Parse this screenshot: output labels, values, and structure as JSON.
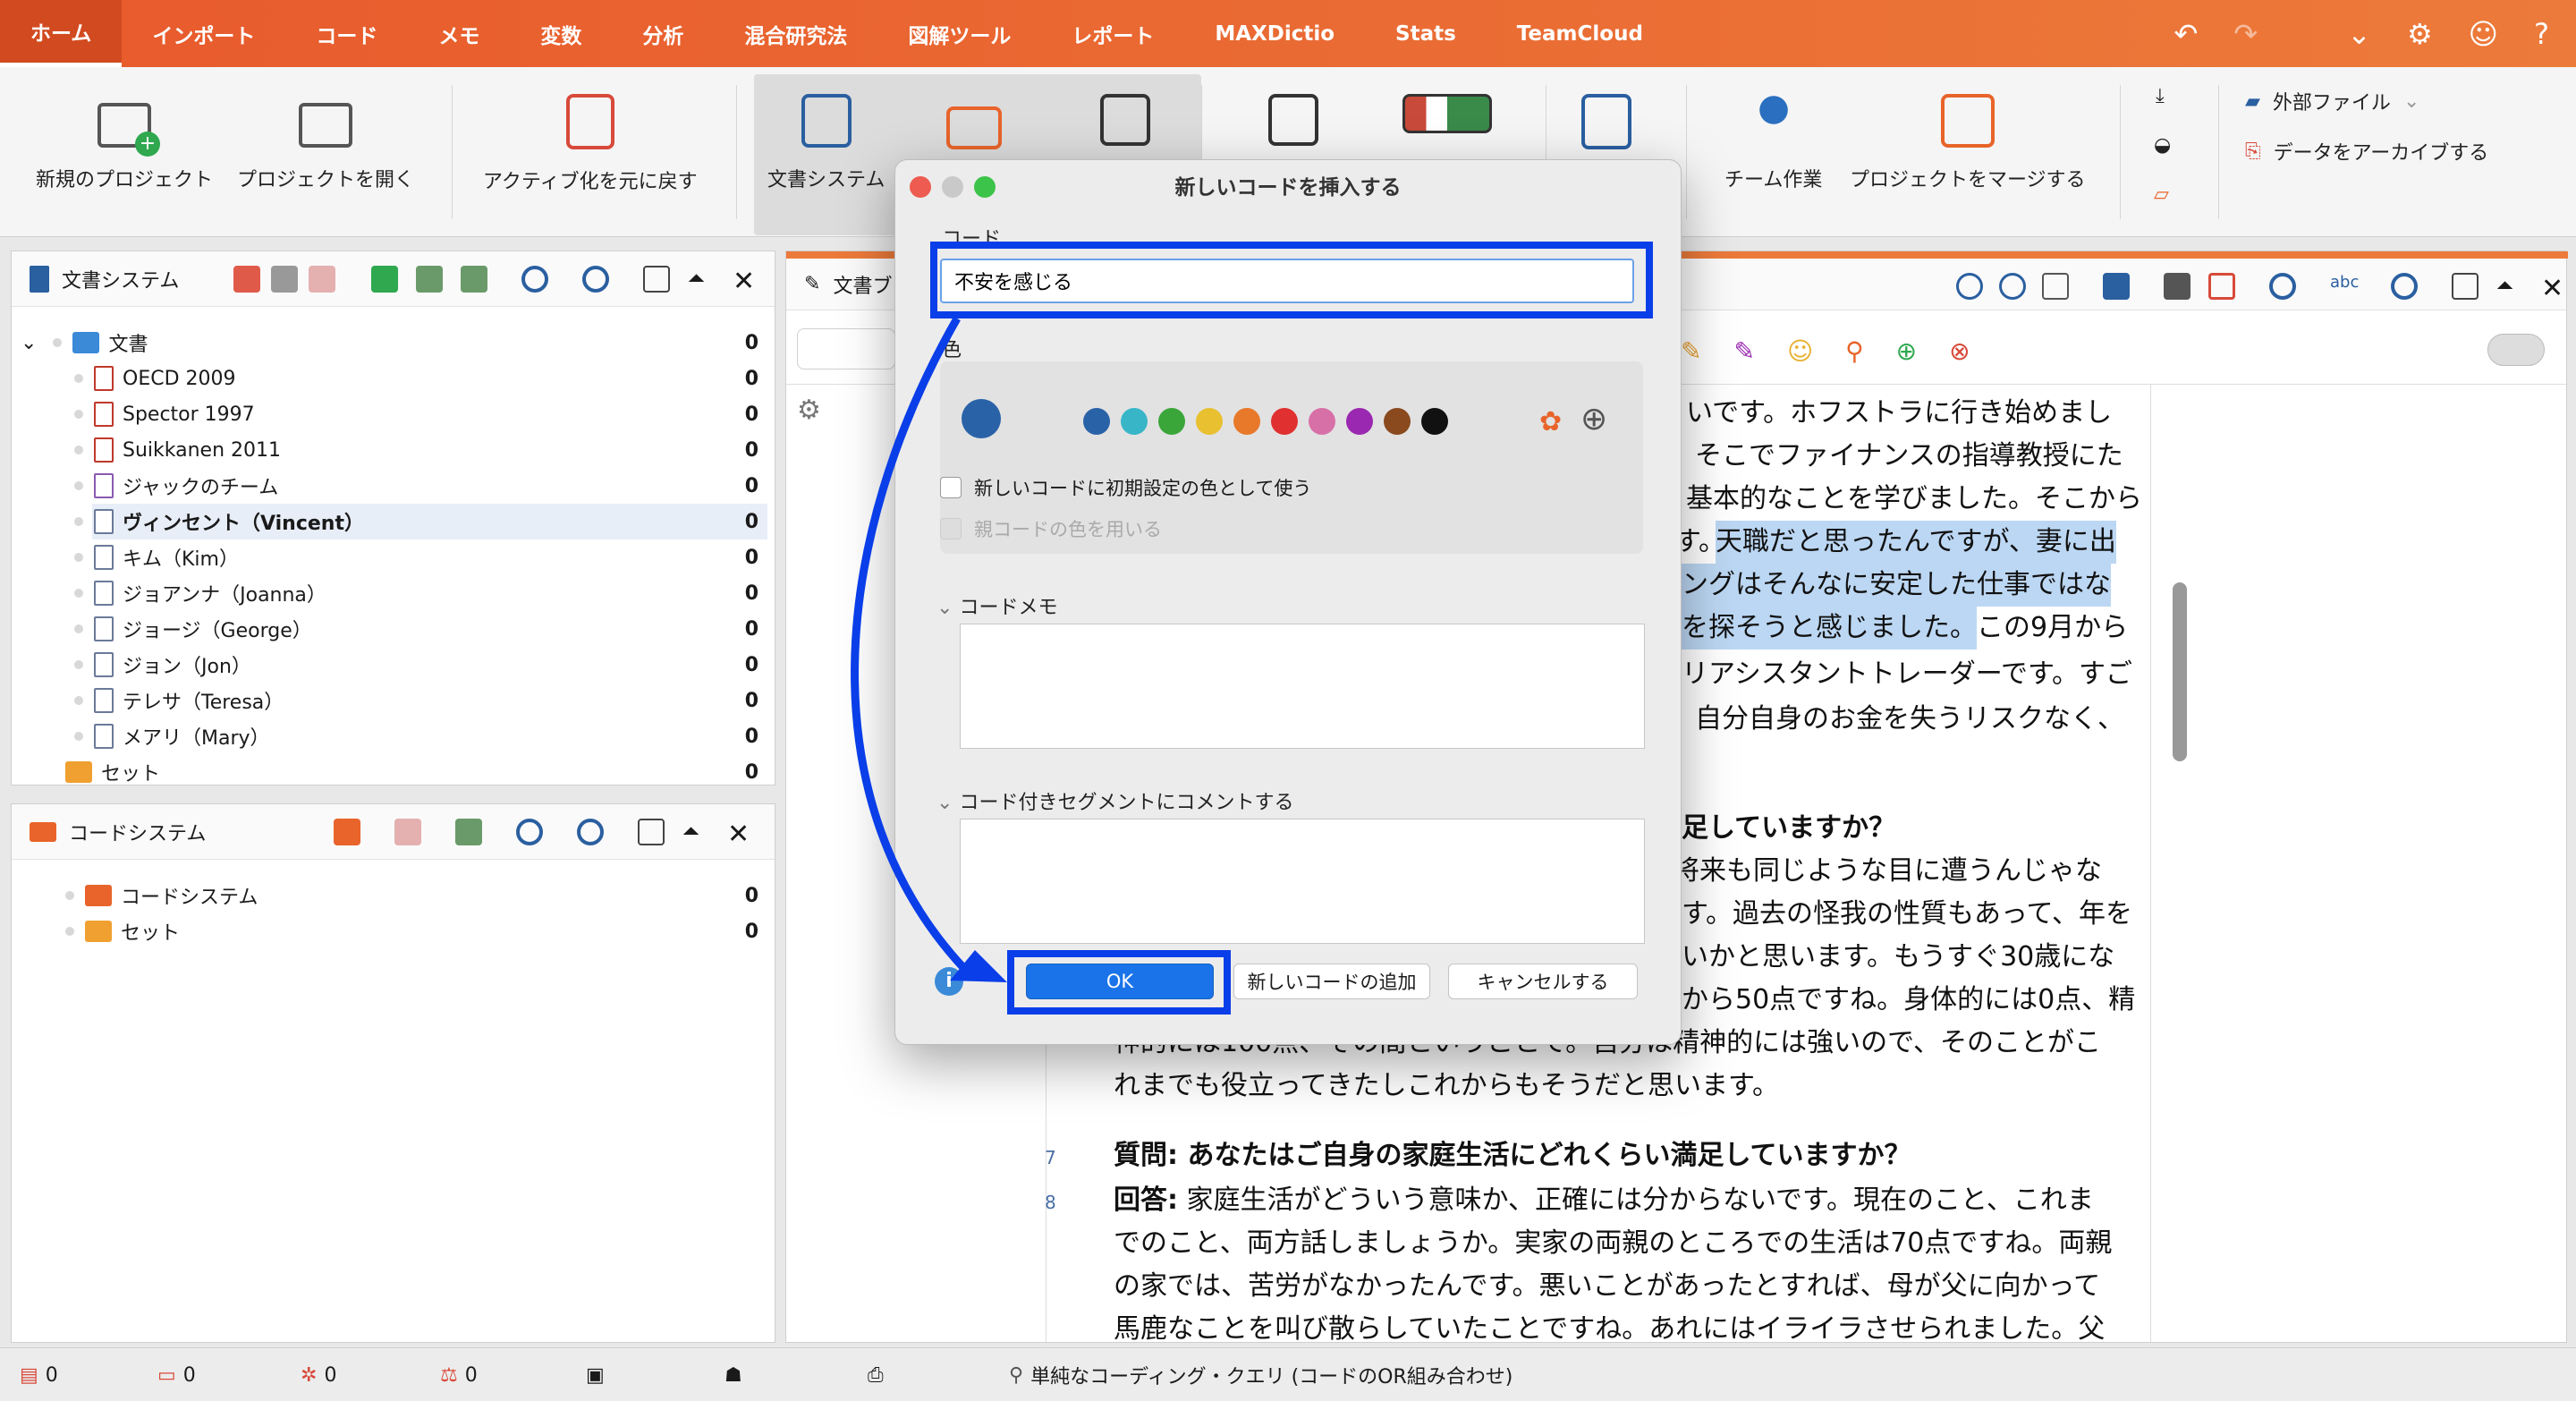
{
  "menu": [
    "ホーム",
    "インポート",
    "コード",
    "メモ",
    "変数",
    "分析",
    "混合研究法",
    "図解ツール",
    "レポート",
    "MAXDictio",
    "Stats",
    "TeamCloud"
  ],
  "ribbon": {
    "new_project": "新規のプロジェクト",
    "open_project": "プロジェクトを開く",
    "undo_activation": "アクティブ化を元に戻す",
    "doc_system": "文書システム",
    "team_work": "チーム作業",
    "merge_project": "プロジェクトをマージする",
    "external_files": "外部ファイル",
    "archive_data": "データをアーカイブする"
  },
  "doc_panel": {
    "title": "文書システム",
    "root": "文書",
    "root_count": "0",
    "items": [
      {
        "label": "OECD 2009",
        "count": "0",
        "type": "pdf"
      },
      {
        "label": "Spector 1997",
        "count": "0",
        "type": "pdf"
      },
      {
        "label": "Suikkanen 2011",
        "count": "0",
        "type": "pdf"
      },
      {
        "label": "ジャックのチーム",
        "count": "0",
        "type": "image"
      },
      {
        "label": "ヴィンセント（Vincent）",
        "count": "0",
        "type": "text"
      },
      {
        "label": "キム（Kim）",
        "count": "0",
        "type": "text"
      },
      {
        "label": "ジョアンナ（Joanna）",
        "count": "0",
        "type": "text"
      },
      {
        "label": "ジョージ（George）",
        "count": "0",
        "type": "text"
      },
      {
        "label": "ジョン（Jon）",
        "count": "0",
        "type": "text"
      },
      {
        "label": "テレサ（Teresa）",
        "count": "0",
        "type": "text"
      },
      {
        "label": "メアリ（Mary）",
        "count": "0",
        "type": "text"
      }
    ],
    "sets_label": "セット",
    "sets_count": "0"
  },
  "code_panel": {
    "title": "コードシステム",
    "root": "コードシステム",
    "root_count": "0",
    "sets_label": "セット",
    "sets_count": "0"
  },
  "browser": {
    "tab_label": "文書ブ",
    "lines": [
      "いです。ホフストラに行き始めまし",
      "そこでファイナンスの指導教授にた",
      "基本的なことを学びました。そこから",
      "す。",
      "天職だと思ったんですが、妻に出",
      "ングはそんなに安定した仕事ではな",
      "を探そうと感じました。",
      "この9月から",
      "リアシスタントトレーダーです。すご",
      "自分自身のお金を失うリスクなく、",
      "足していますか？",
      "将来も同じような目に遭うんじゃな",
      "す。過去の怪我の性質もあって、年を",
      "いかと思います。もうすぐ30歳にな",
      "から50点ですね。身体的には0点、精",
      "神的には100点、その間ということで。自分は精神的には強いので、そのことがこ",
      "れまでも役立ってきたしこれからもそうだと思います。"
    ],
    "q_label": "質問:",
    "q_text": "あなたはご自身の家庭生活にどれくらい満足していますか？",
    "a_label": "回答:",
    "a_text": "家庭生活がどういう意味か、正確には分からないです。現在のこと、これま",
    "a_lines": [
      "でのこと、両方話しましょうか。実家の両親のところでの生活は70点ですね。両親",
      "の家では、苦労がなかったんです。悪いことがあったとすれば、母が父に向かって",
      "馬鹿なことを叫び散らしていたことですね。あれにはイライラさせられました。父"
    ],
    "line_nums": [
      "7",
      "8"
    ]
  },
  "dialog": {
    "title": "新しいコードを挿入する",
    "code_label": "コード",
    "code_value": "不安を感じる",
    "color_label": "色",
    "default_color_check": "新しいコードに初期設定の色として使う",
    "parent_color_check": "親コードの色を用いる",
    "code_memo_label": "コードメモ",
    "segment_comment_label": "コード付きセグメントにコメントする",
    "ok": "OK",
    "add_new": "新しいコードの追加",
    "cancel": "キャンセルする",
    "selected_color": "#2a62a8",
    "palette": [
      "#2a62a8",
      "#38b6c8",
      "#3aa63a",
      "#e8c030",
      "#e8782a",
      "#e03030",
      "#d870a8",
      "#9a28b0",
      "#8a4a1e",
      "#111111"
    ]
  },
  "status": {
    "s1": "0",
    "s2": "0",
    "s3": "0",
    "s4": "0",
    "query": "単純なコーディング・クエリ (コードのOR組み合わせ)"
  }
}
